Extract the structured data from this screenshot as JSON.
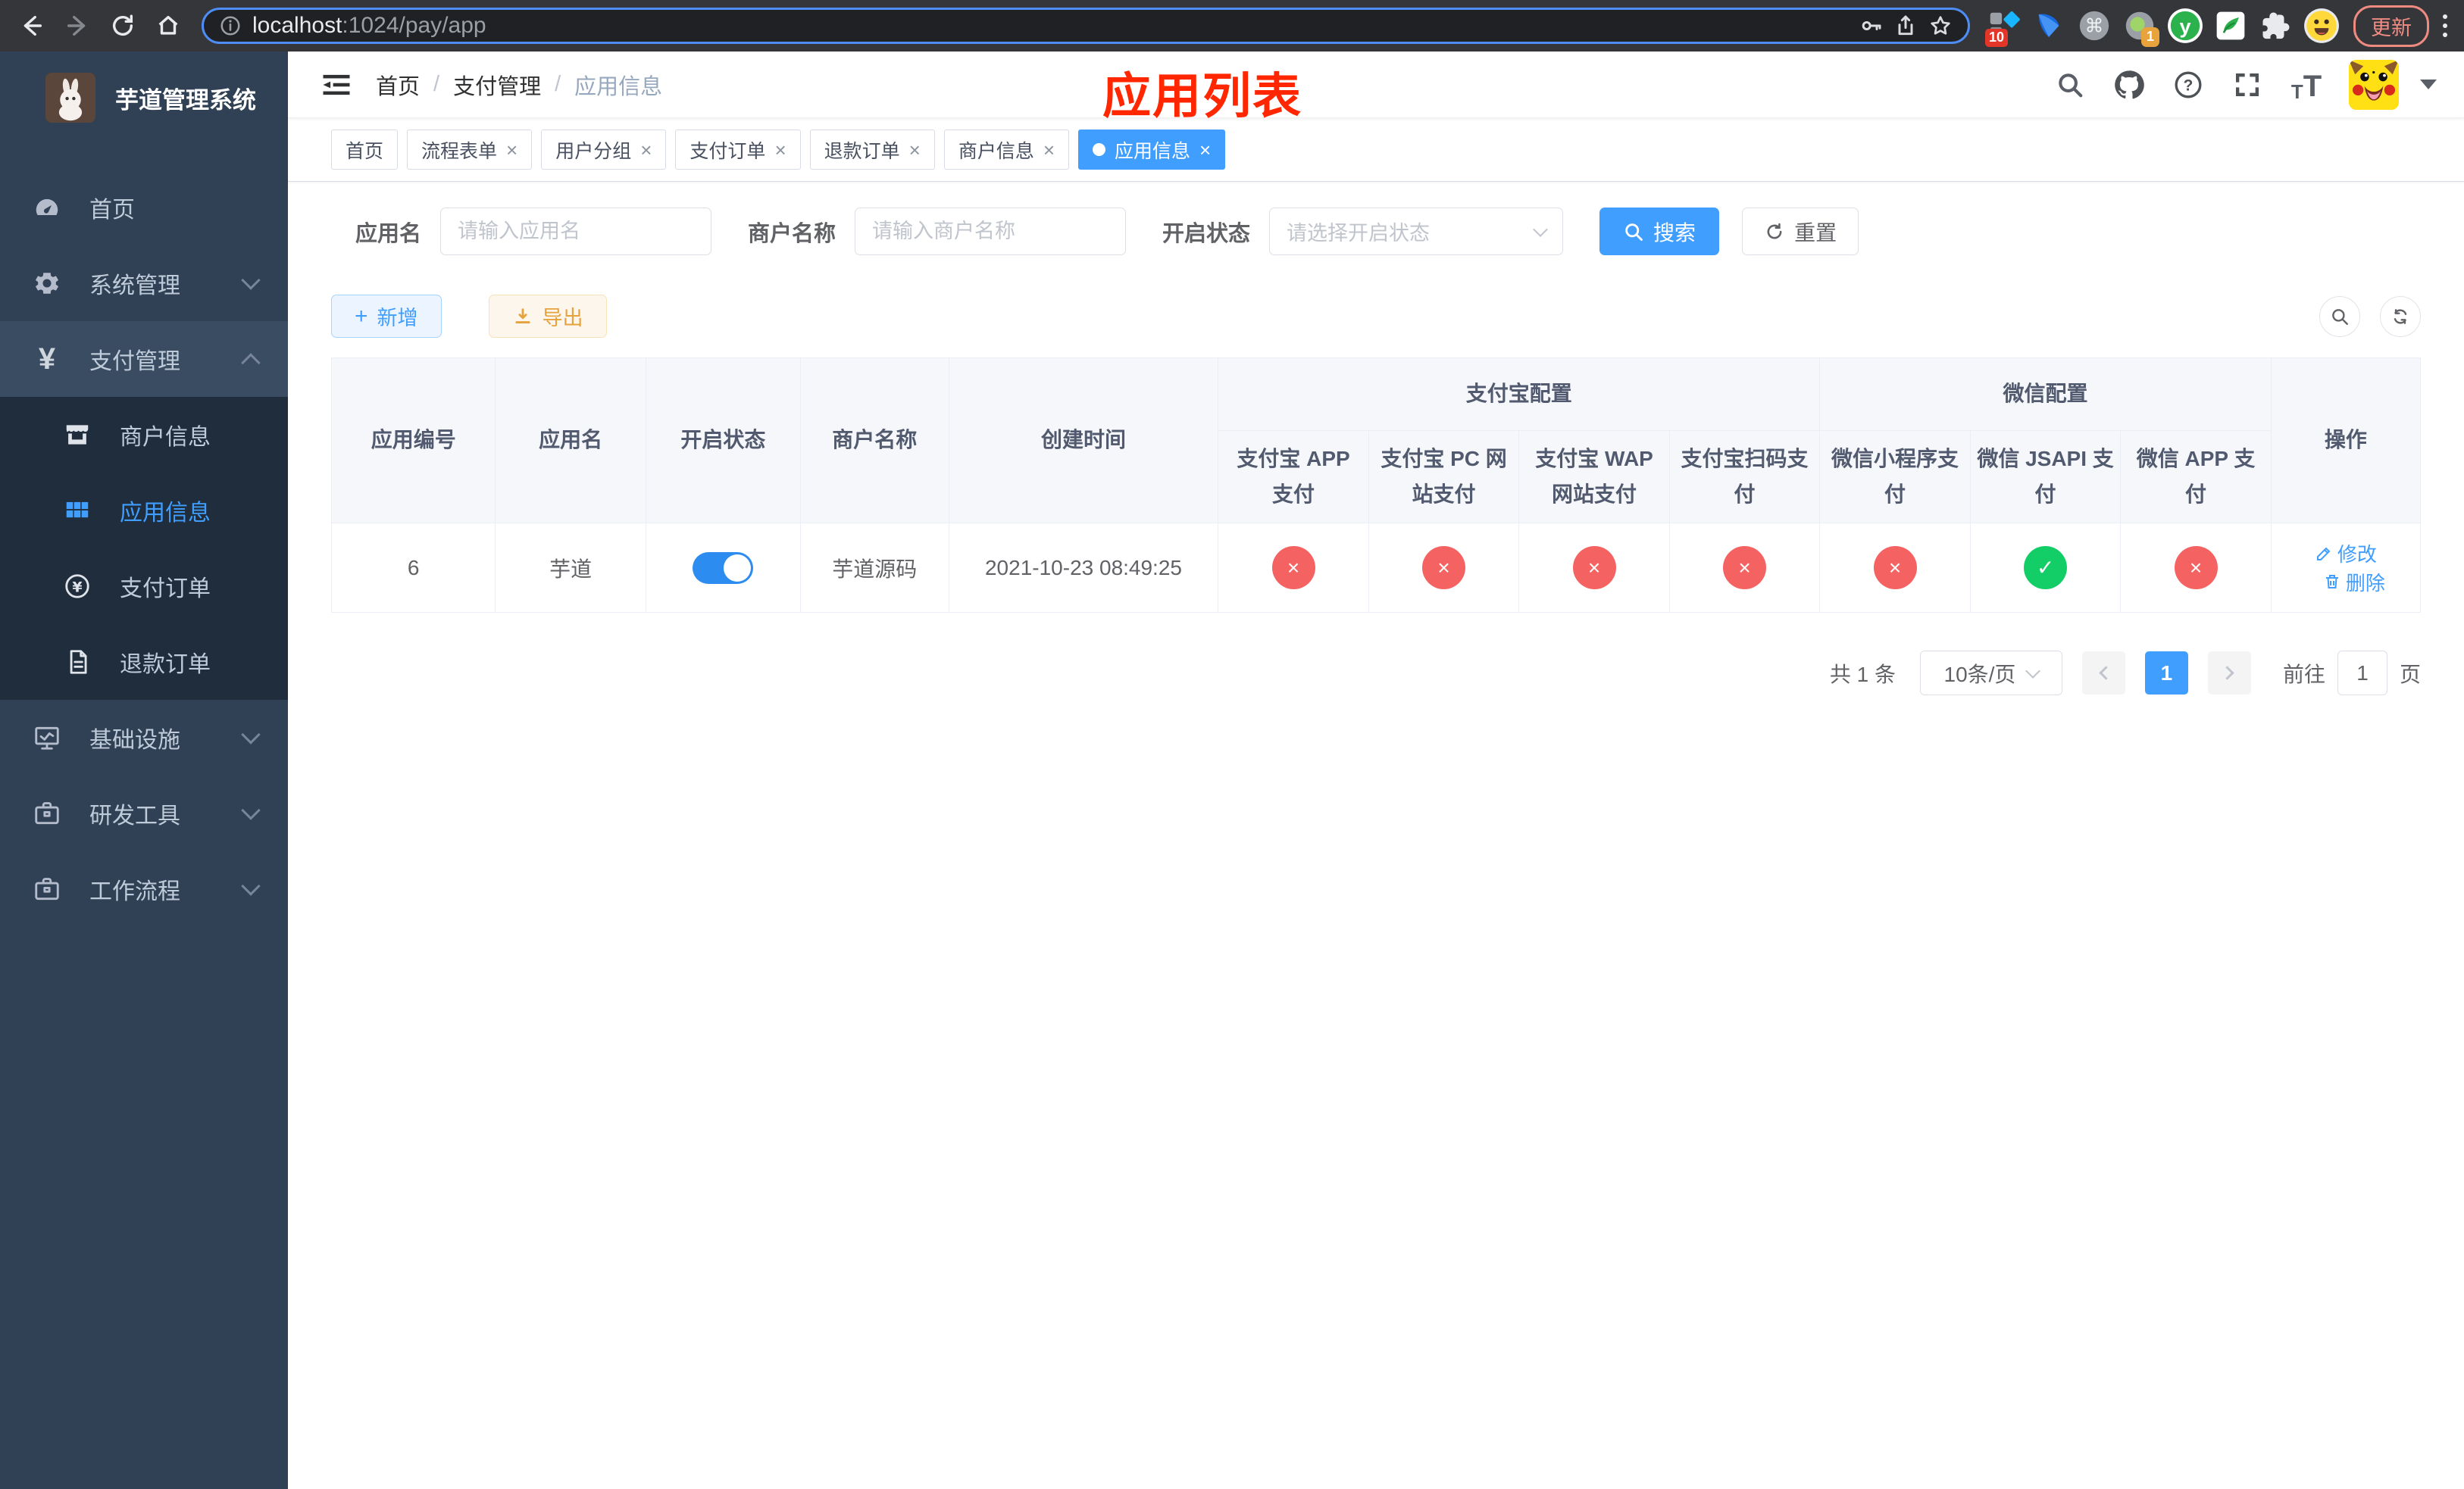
{
  "browser": {
    "url_host": "localhost",
    "url_rest": ":1024/pay/app",
    "update_label": "更新",
    "ext_badge_ten": "10",
    "ext_badge_one": "1",
    "ext_y_letter": "y"
  },
  "sidebar": {
    "title": "芋道管理系统",
    "items": [
      {
        "label": "首页"
      },
      {
        "label": "系统管理"
      },
      {
        "label": "支付管理"
      },
      {
        "label": "商户信息"
      },
      {
        "label": "应用信息"
      },
      {
        "label": "支付订单"
      },
      {
        "label": "退款订单"
      },
      {
        "label": "基础设施"
      },
      {
        "label": "研发工具"
      },
      {
        "label": "工作流程"
      }
    ]
  },
  "header": {
    "breadcrumb": [
      "首页",
      "支付管理",
      "应用信息"
    ],
    "annotation": "应用列表"
  },
  "tabs": [
    {
      "label": "首页",
      "closable": false,
      "active": false
    },
    {
      "label": "流程表单",
      "closable": true,
      "active": false
    },
    {
      "label": "用户分组",
      "closable": true,
      "active": false
    },
    {
      "label": "支付订单",
      "closable": true,
      "active": false
    },
    {
      "label": "退款订单",
      "closable": true,
      "active": false
    },
    {
      "label": "商户信息",
      "closable": true,
      "active": false
    },
    {
      "label": "应用信息",
      "closable": true,
      "active": true
    }
  ],
  "filters": {
    "app_name_label": "应用名",
    "app_name_placeholder": "请输入应用名",
    "merchant_label": "商户名称",
    "merchant_placeholder": "请输入商户名称",
    "status_label": "开启状态",
    "status_placeholder": "请选择开启状态",
    "search_label": "搜索",
    "reset_label": "重置"
  },
  "toolbar": {
    "add_label": "新增",
    "export_label": "导出"
  },
  "table": {
    "headers": {
      "app_id": "应用编号",
      "app_name": "应用名",
      "open_status": "开启状态",
      "merchant_name": "商户名称",
      "create_time": "创建时间",
      "alipay_group": "支付宝配置",
      "wechat_group": "微信配置",
      "alipay_app": "支付宝 APP 支付",
      "alipay_pc": "支付宝 PC 网站支付",
      "alipay_wap": "支付宝 WAP 网站支付",
      "alipay_qr": "支付宝扫码支付",
      "wx_mini": "微信小程序支付",
      "wx_jsapi": "微信 JSAPI 支付",
      "wx_app": "微信 APP 支付",
      "actions": "操作"
    },
    "row": {
      "app_id": "6",
      "app_name": "芋道",
      "open": true,
      "merchant_name": "芋道源码",
      "create_time": "2021-10-23 08:49:25",
      "statuses": [
        false,
        false,
        false,
        false,
        false,
        true,
        false
      ],
      "edit_label": "修改",
      "delete_label": "删除"
    }
  },
  "pagination": {
    "total": "共 1 条",
    "page_size": "10条/页",
    "current_page": "1",
    "goto_prefix": "前往",
    "goto_value": "1",
    "goto_suffix": "页"
  },
  "colors": {
    "accent": "#409eff",
    "success": "#13ce66",
    "danger": "#f56262",
    "annotation_red": "#ff2600",
    "export_orange": "#e6a23c"
  }
}
